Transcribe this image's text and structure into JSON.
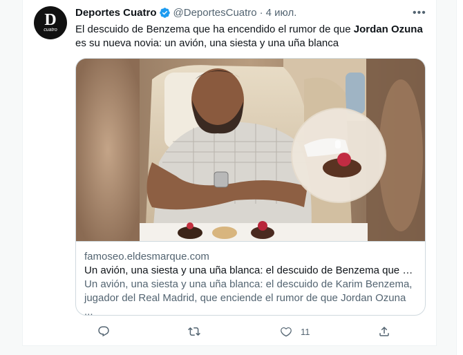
{
  "tweet": {
    "author_name": "Deportes Cuatro",
    "handle": "@DeportesCuatro",
    "separator": "·",
    "date": "4 июл.",
    "avatar_letter": "D",
    "avatar_sub": "cuatro",
    "text_part1": "El descuido de Benzema que ha encendido el rumor de que ",
    "text_bold": "Jordan Ozuna",
    "text_part2": " es su nueva novia: un avión, una siesta y una uña blanca",
    "more_label": "•••"
  },
  "card": {
    "domain": "famoseo.eldesmarque.com",
    "title": "Un avión, una siesta y una uña blanca: el descuido de Benzema que h...",
    "description": "Un avión, una siesta y una uña blanca: el descuido de Karim Benzema, jugador del Real Madrid, que enciende el rumor de que Jordan Ozuna ..."
  },
  "actions": {
    "reply_count": "",
    "retweet_count": "",
    "like_count": "11"
  },
  "colors": {
    "verified": "#1d9bf0",
    "secondary_text": "#536471",
    "border": "#cfd9de"
  },
  "icons": [
    "verified-badge-icon",
    "more-icon",
    "reply-icon",
    "retweet-icon",
    "like-icon",
    "share-icon"
  ]
}
